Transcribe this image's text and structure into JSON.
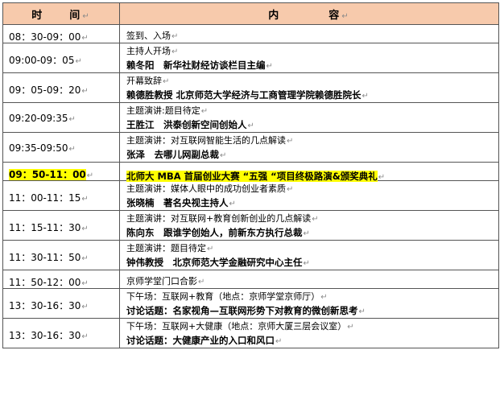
{
  "header": {
    "time_a": "时",
    "time_b": "间",
    "content_a": "内",
    "content_b": "容"
  },
  "para_mark": "↵",
  "rows": [
    {
      "time": "08：30-09：00",
      "lines": [
        "签到、入场"
      ]
    },
    {
      "time": "09:00-09：05",
      "lines": [
        "主持人开场",
        "赖冬阳　新华社财经访谈栏目主编"
      ]
    },
    {
      "time": "09：05-09：20",
      "lines": [
        "开幕致辞",
        "赖德胜教授 北京师范大学经济与工商管理学院赖德胜院长"
      ]
    },
    {
      "time": "09:20-09:35",
      "lines": [
        "主题演讲:题目待定",
        "王胜江　洪泰创新空间创始人"
      ]
    },
    {
      "time": "09:35-09:50",
      "lines": [
        "主题演讲：对互联网智能生活的几点解读",
        "张泽　去哪儿网副总裁"
      ]
    },
    {
      "time": "09：50-11：00",
      "lines": [
        "北师大 MBA 首届创业大赛 “五强 “项目终极路演&颁奖典礼"
      ],
      "highlight": true
    },
    {
      "time": "11：00-11：15",
      "lines": [
        "主题演讲：媒体人眼中的成功创业者素质",
        "张晓楠　著名央视主持人"
      ]
    },
    {
      "time": "11：15-11：30",
      "lines": [
        "主题演讲：对互联网+教育创新创业的几点解读",
        "陈向东　跟谁学创始人，前新东方执行总裁"
      ]
    },
    {
      "time": "11：30-11：50",
      "lines": [
        "主题演讲：题目待定",
        "钟伟教授　北京师范大学金融研究中心主任"
      ]
    },
    {
      "time": "11：50-12：00",
      "lines": [
        "京师学堂门口合影"
      ]
    },
    {
      "time": "13：30-16：30",
      "lines": [
        "下午场：互联网+教育（地点：京师学堂京师厅）",
        "讨论话题：名家视角—互联网形势下对教育的微创新思考"
      ]
    },
    {
      "time": "13：30-16：30",
      "lines": [
        "下午场：互联网+大健康（地点：京师大厦三层会议室）",
        "讨论话题：大健康产业的入口和风口"
      ]
    }
  ]
}
